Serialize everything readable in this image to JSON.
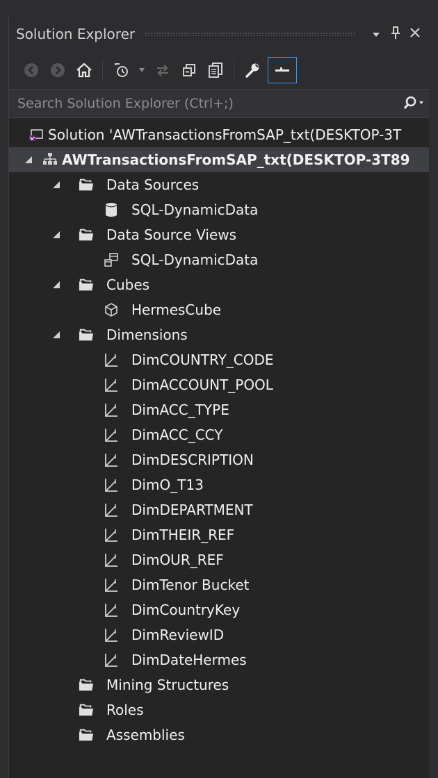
{
  "panel": {
    "title": "Solution Explorer",
    "buttons": {
      "dropdown": "▾",
      "pin": "ᵽ",
      "close": "✕"
    }
  },
  "toolbar": {
    "icons": [
      "back-icon",
      "forward-icon",
      "home-icon",
      "pending-changes-icon",
      "dropdown-icon",
      "sync-icon",
      "collapse-all-icon",
      "show-all-files-icon",
      "properties-icon",
      "preview-selected-icon"
    ],
    "accent_color": "#3399ff"
  },
  "search": {
    "placeholder": "Search Solution Explorer (Ctrl+;)"
  },
  "tree": {
    "solution": "Solution 'AWTransactionsFromSAP_txt(DESKTOP-3T",
    "project": "AWTransactionsFromSAP_txt(DESKTOP-3T89",
    "data_sources": {
      "label": "Data Sources",
      "items": [
        "SQL-DynamicData"
      ]
    },
    "data_source_views": {
      "label": "Data Source Views",
      "items": [
        "SQL-DynamicData"
      ]
    },
    "cubes": {
      "label": "Cubes",
      "items": [
        "HermesCube"
      ]
    },
    "dimensions": {
      "label": "Dimensions",
      "items": [
        "DimCOUNTRY_CODE",
        "DimACCOUNT_POOL",
        "DimACC_TYPE",
        "DimACC_CCY",
        "DimDESCRIPTION",
        "DimO_T13",
        "DimDEPARTMENT",
        "DimTHEIR_REF",
        "DimOUR_REF",
        "DimTenor Bucket",
        "DimCountryKey",
        "DimReviewID",
        "DimDateHermes"
      ]
    },
    "mining_structures": "Mining Structures",
    "roles": "Roles",
    "assemblies": "Assemblies"
  },
  "colors": {
    "background": "#252526",
    "text": "#f1f1f1",
    "selected_row": "#3f3f46",
    "accent": "#3399ff"
  }
}
